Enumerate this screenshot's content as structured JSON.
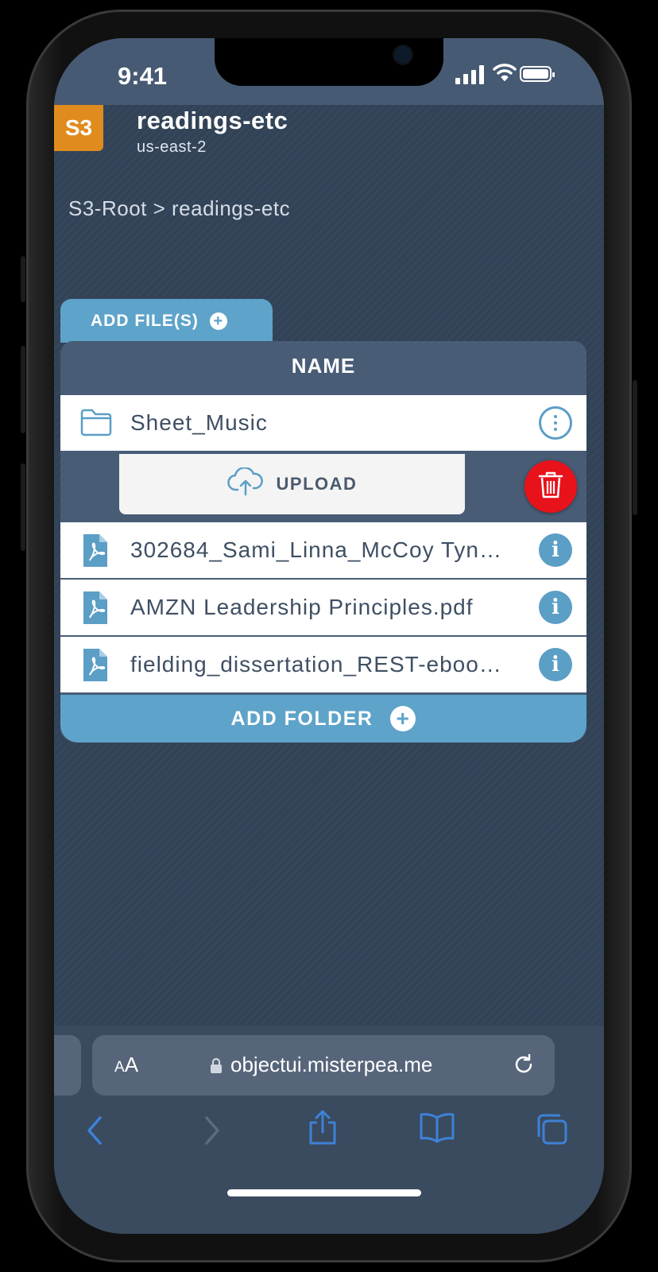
{
  "status_bar": {
    "time": "9:41"
  },
  "bucket": {
    "badge": "S3",
    "name": "readings-etc",
    "region": "us-east-2"
  },
  "breadcrumb": "S3-Root > readings-etc",
  "add_files_label": "ADD FILE(S)",
  "table": {
    "header": "NAME",
    "folder": {
      "name": "Sheet_Music",
      "icon": "folder-icon",
      "action_icon": "more-vertical-icon"
    },
    "upload_label": "UPLOAD",
    "files": [
      {
        "name": "302684_Sami_Linna_McCoy Tyn…",
        "icon": "pdf-file-icon"
      },
      {
        "name": "AMZN Leadership Principles.pdf",
        "icon": "pdf-file-icon"
      },
      {
        "name": "fielding_dissertation_REST-eboo…",
        "icon": "pdf-file-icon"
      }
    ]
  },
  "add_folder_label": "ADD FOLDER",
  "browser": {
    "text_size_label": "AA",
    "url": "objectui.misterpea.me"
  },
  "colors": {
    "accent": "#5ea3c9",
    "badge": "#e08b1e",
    "delete": "#e8121b",
    "browser_icons": "#3d82d6"
  }
}
